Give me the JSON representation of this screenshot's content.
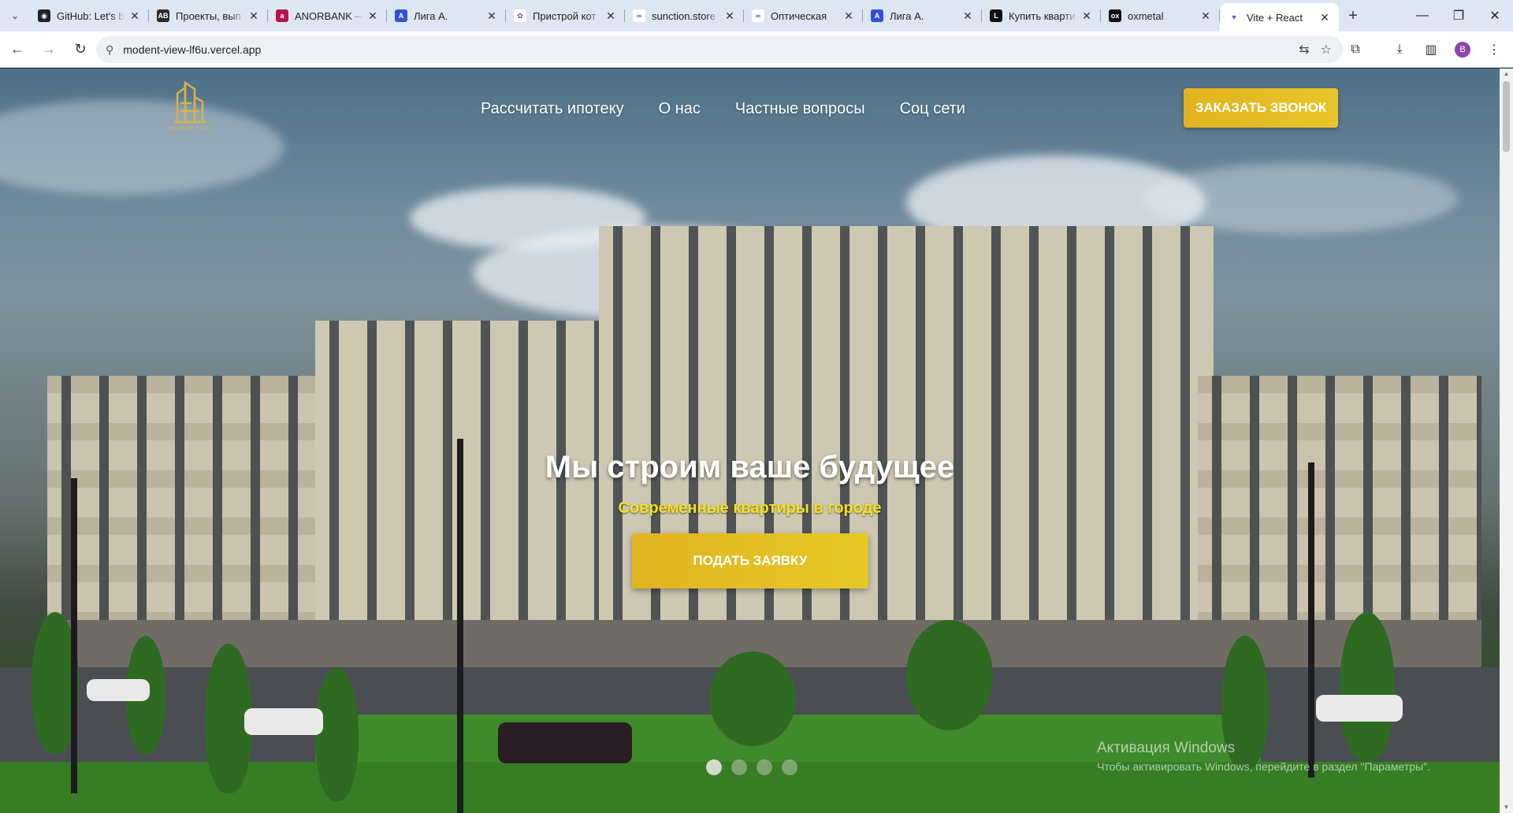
{
  "browser": {
    "tabs": [
      {
        "title": "GitHub: Let's b",
        "icon": "github-icon",
        "color": "#1f2328",
        "glyph": "◉"
      },
      {
        "title": "Проекты, вып",
        "icon": "ab-icon",
        "color": "#2c2c2c",
        "glyph": "AB"
      },
      {
        "title": "ANORBANK —",
        "icon": "anorbank-icon",
        "color": "#b3124e",
        "glyph": "a"
      },
      {
        "title": "Лига А.",
        "icon": "liga-icon",
        "color": "#2f55d4",
        "glyph": "A"
      },
      {
        "title": "Пристрой кот",
        "icon": "figma-icon",
        "color": "#ffffff",
        "glyph": "✿"
      },
      {
        "title": "sunction.store",
        "icon": "link-icon",
        "color": "#ffffff",
        "glyph": "∞"
      },
      {
        "title": "Оптическая",
        "icon": "link-icon",
        "color": "#ffffff",
        "glyph": "∞"
      },
      {
        "title": "Лига А.",
        "icon": "liga-icon",
        "color": "#2f55d4",
        "glyph": "A"
      },
      {
        "title": "Купить кварти",
        "icon": "l-icon",
        "color": "#111111",
        "glyph": "L"
      },
      {
        "title": "oxmetal",
        "icon": "ox-icon",
        "color": "#111111",
        "glyph": "ox"
      },
      {
        "title": "Vite + React",
        "icon": "vite-icon",
        "color": "#ffffff",
        "glyph": "▼",
        "active": true
      }
    ],
    "url": "modent-view-lf6u.vercel.app",
    "avatar_letter": "B"
  },
  "header": {
    "logo_text": "MODERN VIEW",
    "nav": [
      "Рассчитать ипотеку",
      "О нас",
      "Частные вопросы",
      "Соц сети"
    ],
    "call_button": "ЗАКАЗАТЬ ЗВОНОК"
  },
  "hero": {
    "title": "Мы строим ваше будущее",
    "subtitle": "Современные квартиры в городе",
    "apply_button": "ПОДАТЬ ЗАЯВКУ",
    "slides_total": 4,
    "slide_active": 1
  },
  "watermark": {
    "line1": "Активация Windows",
    "line2": "Чтобы активировать Windows, перейдите в раздел \"Параметры\"."
  },
  "colors": {
    "accent": "#e2b321",
    "subtitle": "#f7e21c"
  }
}
